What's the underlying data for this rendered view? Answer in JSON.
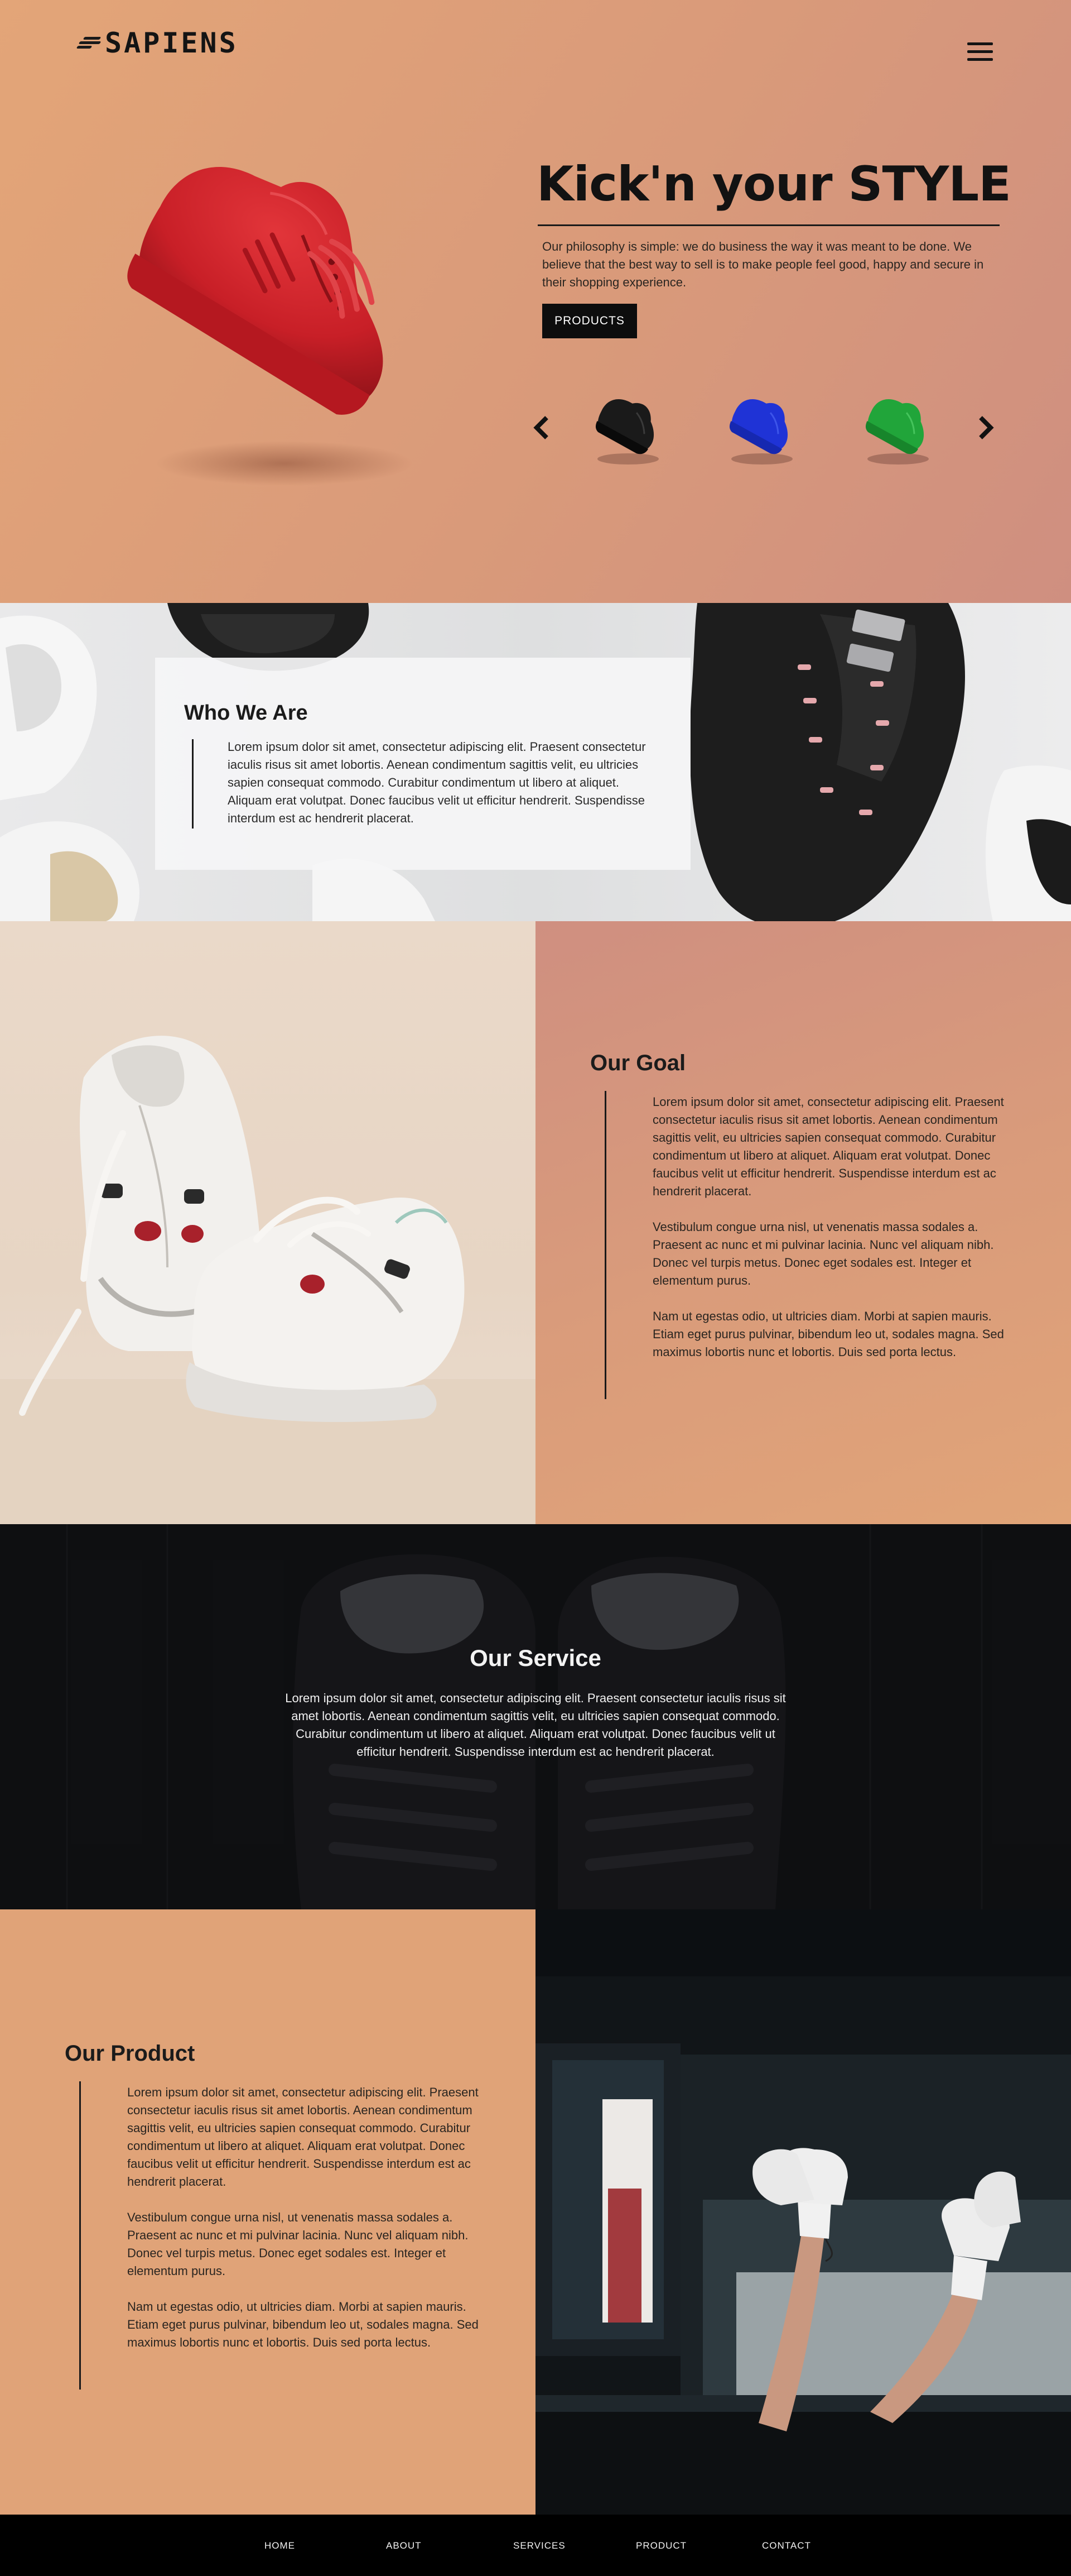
{
  "brand": {
    "name": "SAPIENS"
  },
  "hero": {
    "title": "Kick'n your STYLE",
    "description": "Our philosophy is simple: we do business the way it was meant to be done. We believe that the best way to sell is to make people feel good, happy and secure in their shopping experience.",
    "cta_label": "PRODUCTS",
    "carousel_thumbnails": [
      "black-shoe",
      "blue-shoe",
      "green-shoe"
    ],
    "colors": {
      "featured_shoe": "#d0262d",
      "thumb_black": "#1a1a1a",
      "thumb_blue": "#1f33d6",
      "thumb_green": "#21a53a"
    }
  },
  "who": {
    "title": "Who We Are",
    "text": "Lorem ipsum dolor sit amet, consectetur adipiscing elit. Praesent consectetur iaculis risus sit amet lobortis. Aenean condimentum sagittis velit, eu ultricies sapien consequat commodo. Curabitur condimentum ut libero at aliquet. Aliquam erat volutpat. Donec faucibus velit ut efficitur hendrerit. Suspendisse interdum est ac hendrerit placerat."
  },
  "goal": {
    "title": "Our Goal",
    "paragraphs": [
      "Lorem ipsum dolor sit amet, consectetur adipiscing elit. Praesent consectetur iaculis risus sit amet lobortis. Aenean condimentum sagittis velit, eu ultricies sapien consequat commodo. Curabitur condimentum ut libero at aliquet. Aliquam erat volutpat. Donec faucibus velit ut efficitur hendrerit. Suspendisse interdum est ac hendrerit placerat.",
      "Vestibulum congue urna nisl, ut venenatis massa sodales a. Praesent ac nunc et mi pulvinar lacinia. Nunc vel aliquam nibh. Donec vel turpis metus. Donec eget sodales est. Integer et elementum purus.",
      "Nam ut egestas odio, ut ultricies diam. Morbi at sapien mauris. Etiam eget purus pulvinar, bibendum leo ut, sodales magna. Sed maximus lobortis nunc et lobortis. Duis sed porta lectus."
    ]
  },
  "service": {
    "title": "Our Service",
    "text": "Lorem ipsum dolor sit amet, consectetur adipiscing elit. Praesent consectetur iaculis risus sit amet lobortis. Aenean condimentum sagittis velit, eu ultricies sapien consequat commodo. Curabitur condimentum ut libero at aliquet. Aliquam erat volutpat. Donec faucibus velit ut efficitur hendrerit. Suspendisse interdum est ac hendrerit placerat."
  },
  "product": {
    "title": "Our Product",
    "paragraphs": [
      "Lorem ipsum dolor sit amet, consectetur adipiscing elit. Praesent consectetur iaculis risus sit amet lobortis. Aenean condimentum sagittis velit, eu ultricies sapien consequat commodo. Curabitur condimentum ut libero at aliquet. Aliquam erat volutpat. Donec faucibus velit ut efficitur hendrerit. Suspendisse interdum est ac hendrerit placerat.",
      "Vestibulum congue urna nisl, ut venenatis massa sodales a. Praesent ac nunc et mi pulvinar lacinia. Nunc vel aliquam nibh. Donec vel turpis metus. Donec eget sodales est. Integer et elementum purus.",
      "Nam ut egestas odio, ut ultricies diam. Morbi at sapien mauris. Etiam eget purus pulvinar, bibendum leo ut, sodales magna. Sed maximus lobortis nunc et lobortis. Duis sed porta lectus."
    ]
  },
  "footer": {
    "nav": [
      "HOME",
      "ABOUT",
      "SERVICES",
      "PRODUCT",
      "CONTACT"
    ]
  }
}
